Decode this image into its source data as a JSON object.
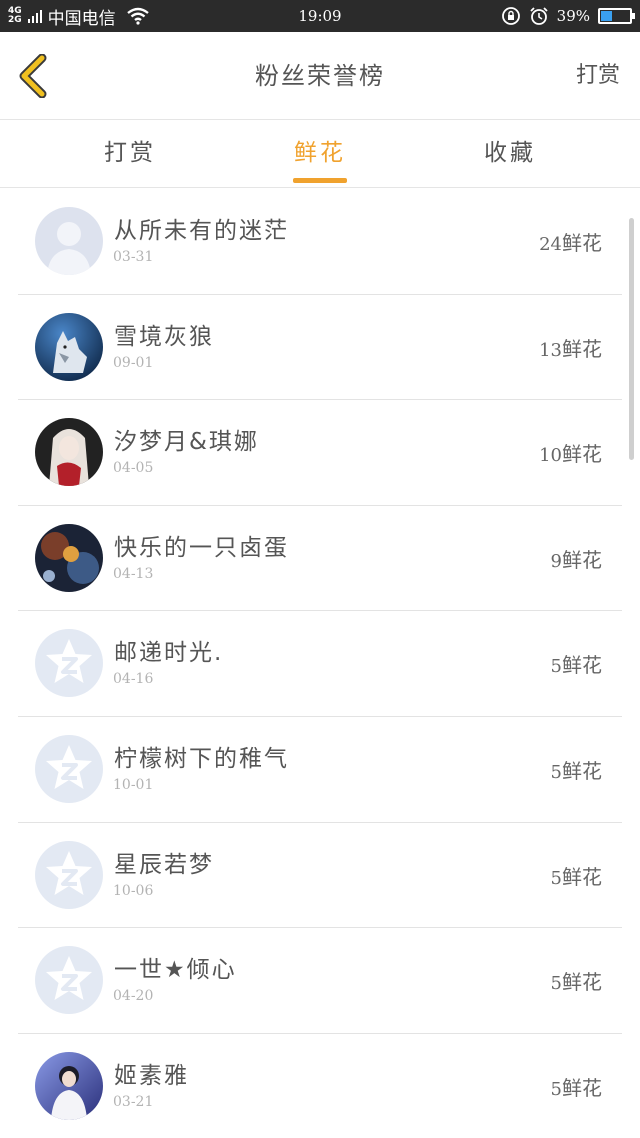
{
  "status_bar": {
    "network_top": "4G",
    "network_bottom": "2G",
    "carrier": "中国电信",
    "time": "19:09",
    "battery_text": "39%",
    "battery_level": 0.39,
    "icons": [
      "signal-icon",
      "wifi-icon",
      "lock-rotation-icon",
      "alarm-icon",
      "battery-icon"
    ]
  },
  "header": {
    "back_icon": "chevron-left-icon",
    "title": "粉丝荣誉榜",
    "action_label": "打赏"
  },
  "tabs": [
    {
      "label": "打赏",
      "active": false
    },
    {
      "label": "鲜花",
      "active": true
    },
    {
      "label": "收藏",
      "active": false
    }
  ],
  "colors": {
    "accent": "#f0a22e",
    "back_icon": "#f0c020"
  },
  "fans": [
    {
      "name": "从所未有的迷茫",
      "date": "03-31",
      "count": "24",
      "unit": "鲜花",
      "avatar": "default-person"
    },
    {
      "name": "雪境灰狼",
      "date": "09-01",
      "count": "13",
      "unit": "鲜花",
      "avatar": "wolf-photo"
    },
    {
      "name": "汐梦月&琪娜",
      "date": "04-05",
      "count": "10",
      "unit": "鲜花",
      "avatar": "anime-girl-photo"
    },
    {
      "name": "快乐的一只卤蛋",
      "date": "04-13",
      "count": "9",
      "unit": "鲜花",
      "avatar": "space-photo"
    },
    {
      "name": "邮递时光.",
      "date": "04-16",
      "count": "5",
      "unit": "鲜花",
      "avatar": "default-star"
    },
    {
      "name": "柠檬树下的稚气",
      "date": "10-01",
      "count": "5",
      "unit": "鲜花",
      "avatar": "default-star"
    },
    {
      "name": "星辰若梦",
      "date": "10-06",
      "count": "5",
      "unit": "鲜花",
      "avatar": "default-star"
    },
    {
      "name": "一世★倾心",
      "date": "04-20",
      "count": "5",
      "unit": "鲜花",
      "avatar": "default-star"
    },
    {
      "name": "姬素雅",
      "date": "03-21",
      "count": "5",
      "unit": "鲜花",
      "avatar": "person-photo"
    }
  ]
}
